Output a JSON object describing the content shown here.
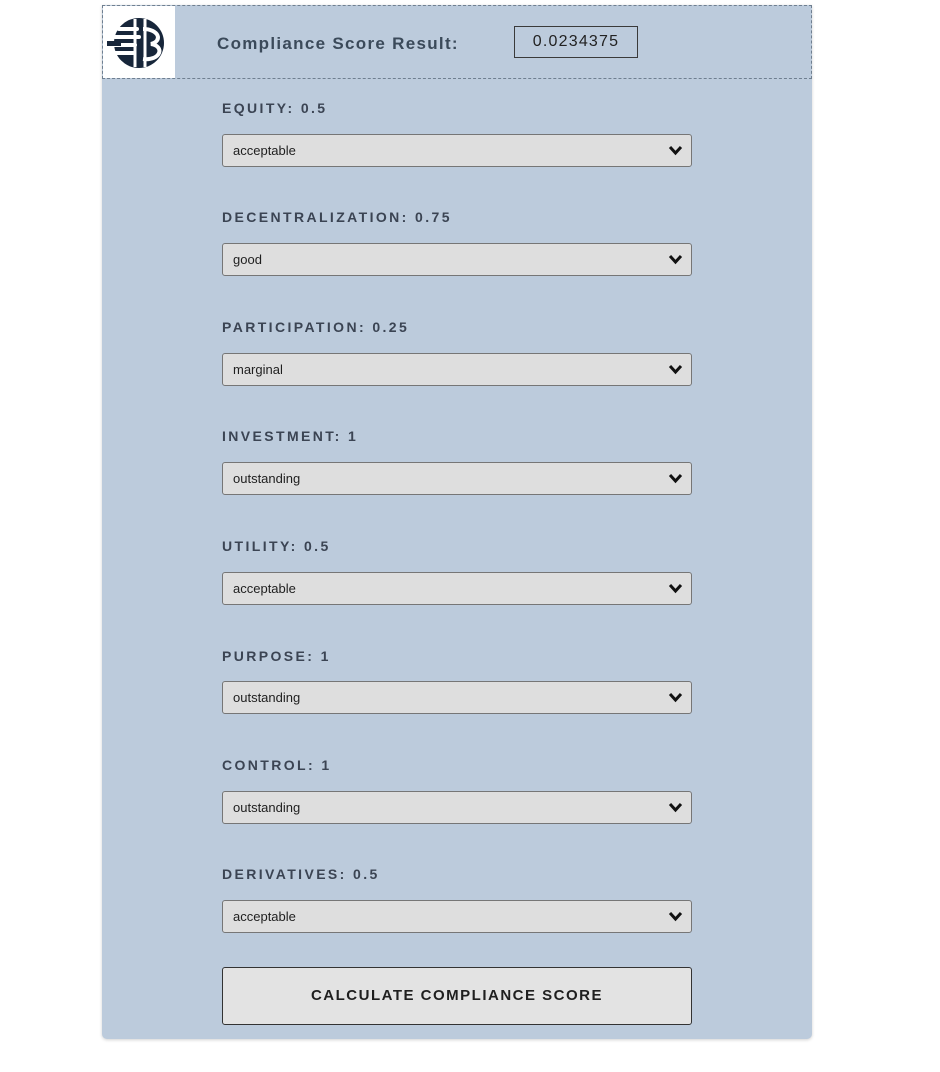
{
  "header": {
    "logo_icon": "crypto-rating-council-logo",
    "result_label": "Compliance Score Result:",
    "result_value": "0.0234375"
  },
  "fields": [
    {
      "label": "EQUITY: 0.5",
      "selected": "acceptable"
    },
    {
      "label": "DECENTRALIZATION: 0.75",
      "selected": "good"
    },
    {
      "label": "PARTICIPATION: 0.25",
      "selected": "marginal"
    },
    {
      "label": "INVESTMENT: 1",
      "selected": "outstanding"
    },
    {
      "label": "UTILITY: 0.5",
      "selected": "acceptable"
    },
    {
      "label": "PURPOSE: 1",
      "selected": "outstanding"
    },
    {
      "label": "CONTROL: 1",
      "selected": "outstanding"
    },
    {
      "label": "DERIVATIVES: 0.5",
      "selected": "acceptable"
    }
  ],
  "calculate_button": "CALCULATE COMPLIANCE SCORE",
  "colors": {
    "panel_bg": "#bccbdc",
    "select_bg": "#dedede",
    "label_text": "#3b4453"
  },
  "icons": {
    "dropdown": "chevron-down-icon"
  }
}
